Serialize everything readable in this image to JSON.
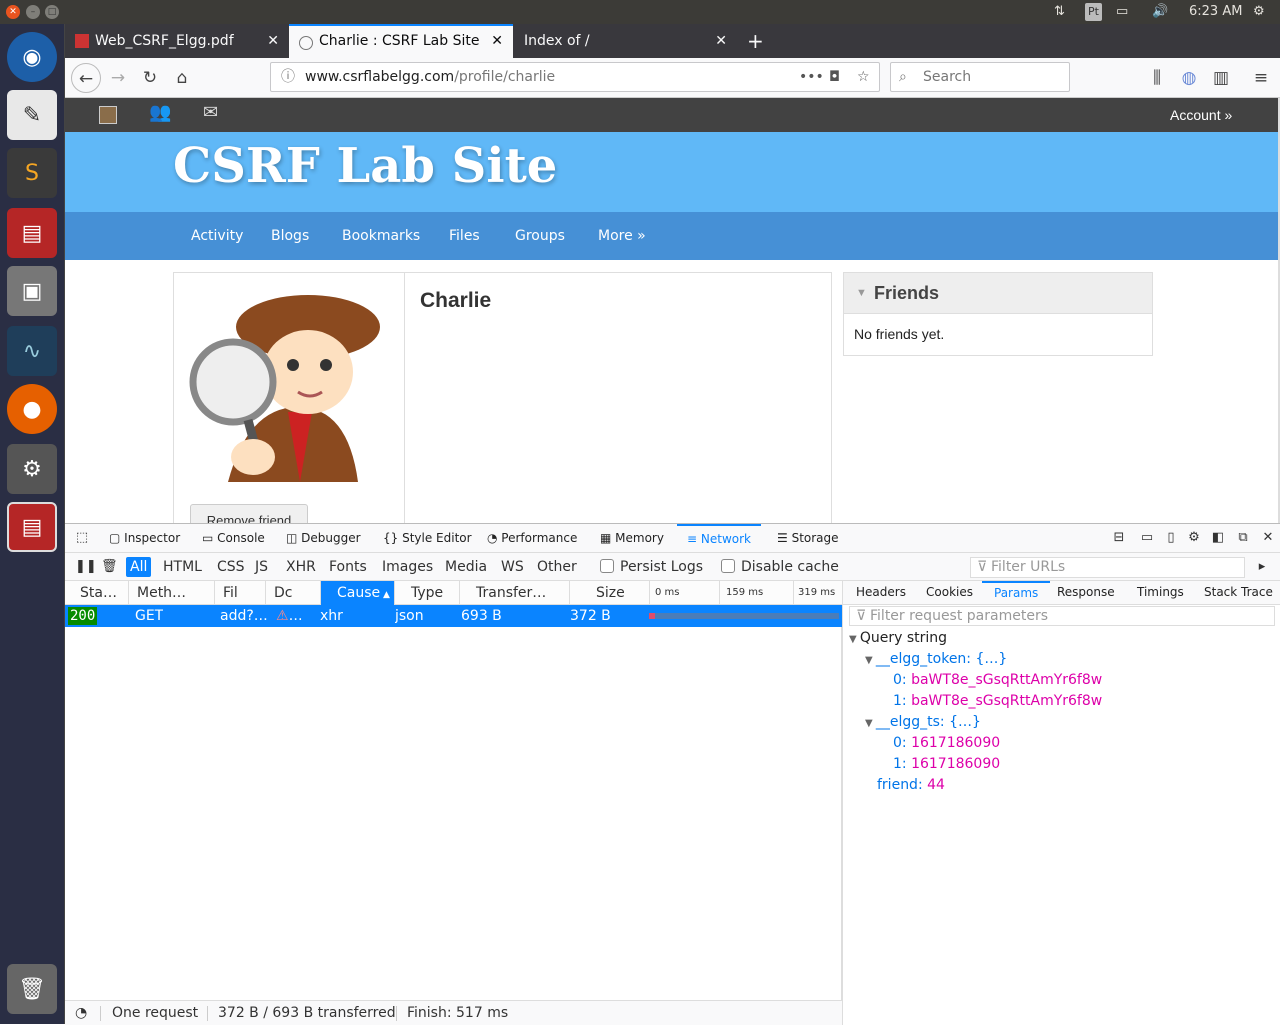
{
  "system": {
    "time": "6:23 AM",
    "tray_badge": "Pt"
  },
  "browser": {
    "tabs": [
      {
        "label": "Web_CSRF_Elgg.pdf"
      },
      {
        "label": "Charlie : CSRF Lab Site"
      },
      {
        "label": "Index of /"
      }
    ],
    "url_host": "www.csrflabelgg.com",
    "url_path": "/profile/charlie",
    "search_placeholder": "Search"
  },
  "page": {
    "topbar_account": "Account »",
    "site_title": "CSRF Lab Site",
    "menu": [
      "Activity",
      "Blogs",
      "Bookmarks",
      "Files",
      "Groups",
      "More »"
    ],
    "profile_name": "Charlie",
    "remove_friend": "Remove friend",
    "friends_title": "Friends",
    "friends_empty": "No friends yet."
  },
  "devtools": {
    "tabs": [
      "Inspector",
      "Console",
      "Debugger",
      "Style Editor",
      "Performance",
      "Memory",
      "Network",
      "Storage"
    ],
    "active_tab": "Network",
    "filters": [
      "All",
      "HTML",
      "CSS",
      "JS",
      "XHR",
      "Fonts",
      "Images",
      "Media",
      "WS",
      "Other"
    ],
    "persist_logs": "Persist Logs",
    "disable_cache": "Disable cache",
    "filter_urls_placeholder": "Filter URLs",
    "columns": [
      "Sta…",
      "Meth…",
      "Fil",
      "Dc",
      "Cause",
      "Type",
      "Transfer…",
      "Size"
    ],
    "sorted_column": "Cause",
    "timeline_ticks": [
      "0 ms",
      "159 ms",
      "319 ms"
    ],
    "request": {
      "status": "200",
      "method": "GET",
      "file": "add?…",
      "domain": "…",
      "cause": "xhr",
      "type": "json",
      "transferred": "693 B",
      "size": "372 B"
    },
    "status_bar": {
      "requests": "One request",
      "transferred": "372 B / 693 B transferred",
      "finish": "Finish: 517 ms"
    },
    "side_tabs": [
      "Headers",
      "Cookies",
      "Params",
      "Response",
      "Timings",
      "Stack Trace"
    ],
    "active_side_tab": "Params",
    "param_filter_placeholder": "Filter request parameters",
    "query_string_label": "Query string",
    "params": {
      "token_key": "__elgg_token: {…}",
      "token_0_key": "0:",
      "token_0": "baWT8e_sGsqRttAmYr6f8w",
      "token_1_key": "1:",
      "token_1": "baWT8e_sGsqRttAmYr6f8w",
      "ts_key": "__elgg_ts: {…}",
      "ts_0_key": "0:",
      "ts_0": "1617186090",
      "ts_1_key": "1:",
      "ts_1": "1617186090",
      "friend_key": "friend:",
      "friend": "44"
    }
  },
  "colors": {
    "accent": "#0a84ff",
    "header_blue": "#60b8f7",
    "menu_blue": "#4690d6",
    "status_ok": "#058b00"
  }
}
